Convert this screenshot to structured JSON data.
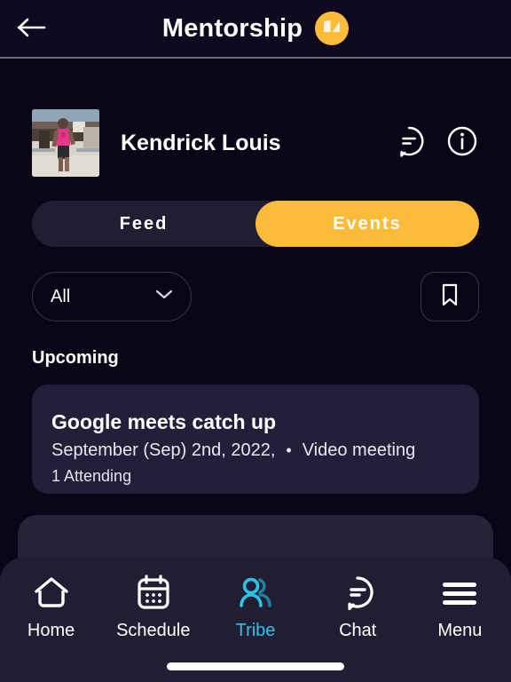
{
  "appbar": {
    "back_icon": "arrow-left-icon",
    "title": "Mentorship",
    "brand_badge_icon": "brand-logo-icon",
    "brand_color": "#FDBB3A"
  },
  "profile": {
    "avatar_alt": "runner-photo",
    "name": "Kendrick Louis",
    "actions": [
      {
        "icon": "chat-bubble-icon"
      },
      {
        "icon": "info-circle-icon"
      }
    ]
  },
  "tabs": [
    {
      "label": "Feed",
      "active": false
    },
    {
      "label": "Events",
      "active": true
    }
  ],
  "filter": {
    "selected": "All",
    "chevron_icon": "chevron-down-icon",
    "bookmark_icon": "bookmark-icon"
  },
  "section": {
    "title": "Upcoming"
  },
  "event": {
    "title": "Google meets catch up",
    "date": "September (Sep) 2nd, 2022,",
    "separator": "•",
    "type": "Video meeting",
    "attending": "1 Attending"
  },
  "bottom_nav": {
    "active_color": "#29C5E8",
    "items": [
      {
        "label": "Home",
        "icon": "home-icon",
        "active": false
      },
      {
        "label": "Schedule",
        "icon": "calendar-icon",
        "active": false
      },
      {
        "label": "Tribe",
        "icon": "people-icon",
        "active": true
      },
      {
        "label": "Chat",
        "icon": "chat-bubble-icon",
        "active": false
      },
      {
        "label": "Menu",
        "icon": "hamburger-icon",
        "active": false
      }
    ]
  }
}
